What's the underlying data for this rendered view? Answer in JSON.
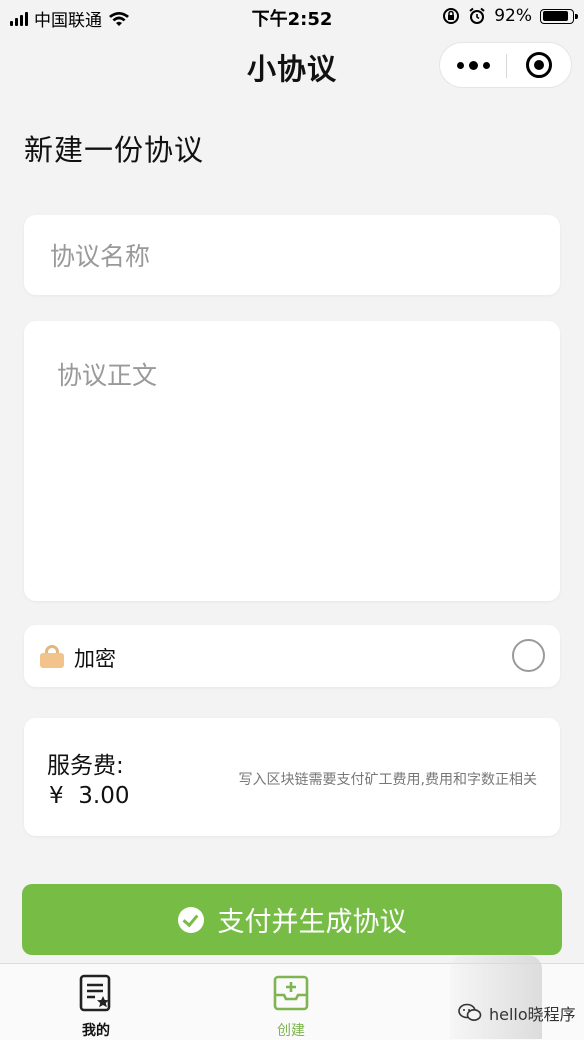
{
  "status_bar": {
    "carrier": "中国联通",
    "time": "下午2:52",
    "battery_percent": "92%",
    "battery_level": 0.92
  },
  "nav": {
    "title": "小协议"
  },
  "page": {
    "title": "新建一份协议"
  },
  "form": {
    "name_placeholder": "协议名称",
    "name_value": "",
    "body_placeholder": "协议正文",
    "body_value": "",
    "encrypt_label": "加密",
    "encrypt_checked": false
  },
  "fee": {
    "label": "服务费:",
    "amount": "¥  3.00",
    "note": "写入区块链需要支付矿工费用,费用和字数正相关"
  },
  "pay_button": {
    "label": "支付并生成协议"
  },
  "tabbar": {
    "items": [
      {
        "label": "我的",
        "icon": "document-star-icon",
        "active": false
      },
      {
        "label": "创建",
        "icon": "create-tray-icon",
        "active": true
      }
    ]
  },
  "watermark": {
    "text": "hello晓程序"
  },
  "colors": {
    "accent_green": "#77bd45",
    "tab_active": "#7fb451",
    "background": "#f3f3f3"
  }
}
